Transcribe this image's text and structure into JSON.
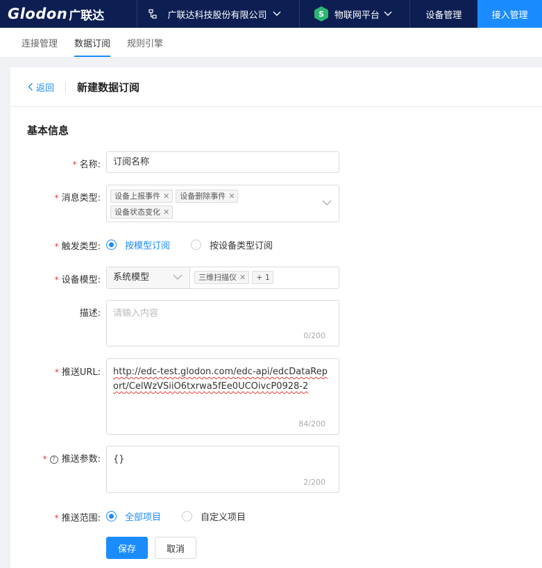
{
  "header": {
    "logo_text": "Glodon",
    "logo_cn": "广联达",
    "company": "广联达科技股份有限公司",
    "platform": "物联网平台",
    "nav": [
      "设备管理",
      "接入管理"
    ]
  },
  "subtabs": [
    "连接管理",
    "数据订阅",
    "规则引擎"
  ],
  "page": {
    "back": "返回",
    "title": "新建数据订阅",
    "section": "基本信息"
  },
  "form": {
    "name": {
      "label": "名称:",
      "value": "订阅名称"
    },
    "msg_type": {
      "label": "消息类型:",
      "tags": [
        "设备上报事件",
        "设备删除事件",
        "设备状态变化"
      ]
    },
    "trigger": {
      "label": "触发类型:",
      "options": [
        "按模型订阅",
        "按设备类型订阅"
      ],
      "selected": 0
    },
    "model": {
      "label": "设备模型:",
      "select": "系统模型",
      "tag": "三维扫描仪",
      "more": "+ 1"
    },
    "desc": {
      "label": "描述:",
      "placeholder": "请输入内容",
      "counter": "0/200"
    },
    "url": {
      "label": "推送URL:",
      "value": "http://edc-test.glodon.com/edc-api/edcDataReport/CelWzVSiiO6txrwa5fEe0UCOivcP0928-2",
      "counter": "84/200"
    },
    "params": {
      "label": "推送参数:",
      "value": "{}",
      "counter": "2/200",
      "help_icon": "?"
    },
    "scope": {
      "label": "推送范围:",
      "options": [
        "全部项目",
        "自定义项目"
      ],
      "selected": 0
    }
  },
  "buttons": {
    "save": "保存",
    "cancel": "取消"
  },
  "colors": {
    "primary": "#1a8cff",
    "header_bg": "#0d1e52",
    "required": "#e53935"
  }
}
